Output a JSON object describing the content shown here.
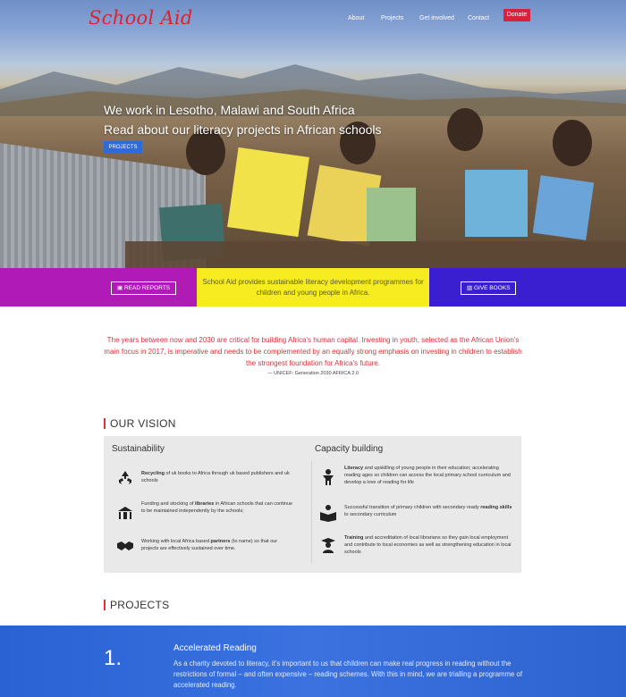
{
  "brand": {
    "logo": "School Aid"
  },
  "nav": {
    "about": "About",
    "projects": "Projects",
    "get_involved": "Get involved",
    "contact": "Contact",
    "donate": "Donate"
  },
  "hero": {
    "line1": "We work in Lesotho, Malawi and South Africa",
    "line2": "Read about our literacy projects in African schools",
    "button": "PROJECTS"
  },
  "strip": {
    "left_button": "READ REPORTS",
    "center_text": "School Aid provides sustainable literacy development programmes for children and young people in Africa.",
    "right_button": "GIVE BOOKS"
  },
  "quote": {
    "text": "The years between now and 2030 are critical for building Africa's human capital. Investing in youth, selected as the African Union's main focus in 2017, is imperative and needs to be complemented by an equally strong emphasis on investing in children to establish the strongest foundation for Africa's future.",
    "source": "— UNICEF: Generation 2030 AFRICA 2.0"
  },
  "vision": {
    "title": "OUR VISION",
    "left_title": "Sustainability",
    "right_title": "Capacity building",
    "left_items": [
      {
        "icon": "recycle-icon",
        "bold": "Recycling",
        "text": " of uk books to Africa through uk based publishers and uk schools"
      },
      {
        "icon": "library-icon",
        "pre": "Funding and stocking of ",
        "bold": "libraries",
        "text": " in African schools that can continue to be maintained independently by the schools;"
      },
      {
        "icon": "handshake-icon",
        "pre": "Working with local Africa based ",
        "bold": "partners",
        "text": " (to name) so that our projects are effectively sustained over time."
      }
    ],
    "right_items": [
      {
        "icon": "child-icon",
        "bold": "Literacy",
        "text": " and upskilling of young people in their education; accelerating reading ages so children can access the local primary school curriculum and develop a love of reading for life"
      },
      {
        "icon": "book-reader-icon",
        "pre": "Successful transition of primary children with secondary ready ",
        "bold": "reading skills",
        "text": " to secondary curriculum"
      },
      {
        "icon": "graduate-icon",
        "bold": "Training",
        "text": " and accreditation of local librarians so they gain local employment and contribute to local economies as well as strengthening education in local schools"
      }
    ]
  },
  "projects": {
    "title": "PROJECTS",
    "item": {
      "number": "1.",
      "title": "Accelerated Reading",
      "text": "As a charity devoted to literacy, it's important to us that children can make real progress in reading without the restrictions of formal – and often expensive – reading schemes. With this in mind, we are trialling a programme of accelerated reading."
    }
  }
}
